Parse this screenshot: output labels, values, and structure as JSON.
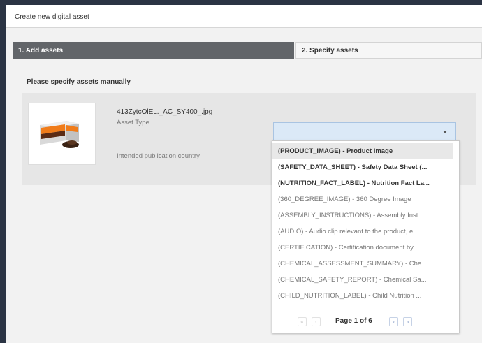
{
  "title": "Create new digital asset",
  "steps": [
    {
      "label": "1. Add assets"
    },
    {
      "label": "2. Specify assets"
    }
  ],
  "section": {
    "label": "Please specify assets manually"
  },
  "asset": {
    "file_name": "413ZytcOlEL._AC_SY400_.jpg",
    "asset_type_label": "Asset Type",
    "country_label": "Intended publication country",
    "asset_type_value": ""
  },
  "dropdown": {
    "options": [
      {
        "label": "(PRODUCT_IMAGE) - Product Image"
      },
      {
        "label": "(SAFETY_DATA_SHEET) - Safety Data Sheet (..."
      },
      {
        "label": "(NUTRITION_FACT_LABEL) - Nutrition Fact La..."
      },
      {
        "label": "(360_DEGREE_IMAGE) - 360 Degree Image"
      },
      {
        "label": "(ASSEMBLY_INSTRUCTIONS) - Assembly Inst..."
      },
      {
        "label": "(AUDIO) - Audio clip relevant to the product, e..."
      },
      {
        "label": "(CERTIFICATION) - Certification document by ..."
      },
      {
        "label": "(CHEMICAL_ASSESSMENT_SUMMARY) - Che..."
      },
      {
        "label": "(CHEMICAL_SAFETY_REPORT) - Chemical Sa..."
      },
      {
        "label": "(CHILD_NUTRITION_LABEL) - Child Nutrition ..."
      }
    ],
    "page_info": "Page 1 of 6",
    "first_icon": "«",
    "prev_icon": "‹",
    "next_icon": "›",
    "last_icon": "»"
  },
  "colors": {
    "background": "#2b3444",
    "active_step": "#626569",
    "select_highlight": "#dbe9f7"
  }
}
